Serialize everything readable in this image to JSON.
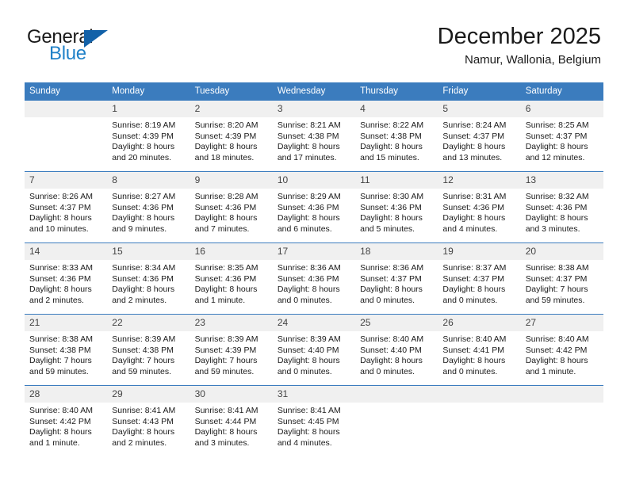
{
  "brand": {
    "name_part1": "General",
    "name_part2": "Blue",
    "triangle_color": "#1261a8",
    "blue_color": "#2081c8"
  },
  "header": {
    "title": "December 2025",
    "subtitle": "Namur, Wallonia, Belgium"
  },
  "theme": {
    "header_bg": "#3b7cbe",
    "day_number_bg": "#f0f0f0",
    "text_color": "#1a1a1a"
  },
  "weekdays": [
    "Sunday",
    "Monday",
    "Tuesday",
    "Wednesday",
    "Thursday",
    "Friday",
    "Saturday"
  ],
  "weeks": [
    [
      {
        "day": "",
        "empty": true,
        "sunrise": "",
        "sunset": "",
        "daylight_line1": "",
        "daylight_line2": ""
      },
      {
        "day": "1",
        "sunrise": "Sunrise: 8:19 AM",
        "sunset": "Sunset: 4:39 PM",
        "daylight_line1": "Daylight: 8 hours",
        "daylight_line2": "and 20 minutes."
      },
      {
        "day": "2",
        "sunrise": "Sunrise: 8:20 AM",
        "sunset": "Sunset: 4:39 PM",
        "daylight_line1": "Daylight: 8 hours",
        "daylight_line2": "and 18 minutes."
      },
      {
        "day": "3",
        "sunrise": "Sunrise: 8:21 AM",
        "sunset": "Sunset: 4:38 PM",
        "daylight_line1": "Daylight: 8 hours",
        "daylight_line2": "and 17 minutes."
      },
      {
        "day": "4",
        "sunrise": "Sunrise: 8:22 AM",
        "sunset": "Sunset: 4:38 PM",
        "daylight_line1": "Daylight: 8 hours",
        "daylight_line2": "and 15 minutes."
      },
      {
        "day": "5",
        "sunrise": "Sunrise: 8:24 AM",
        "sunset": "Sunset: 4:37 PM",
        "daylight_line1": "Daylight: 8 hours",
        "daylight_line2": "and 13 minutes."
      },
      {
        "day": "6",
        "sunrise": "Sunrise: 8:25 AM",
        "sunset": "Sunset: 4:37 PM",
        "daylight_line1": "Daylight: 8 hours",
        "daylight_line2": "and 12 minutes."
      }
    ],
    [
      {
        "day": "7",
        "sunrise": "Sunrise: 8:26 AM",
        "sunset": "Sunset: 4:37 PM",
        "daylight_line1": "Daylight: 8 hours",
        "daylight_line2": "and 10 minutes."
      },
      {
        "day": "8",
        "sunrise": "Sunrise: 8:27 AM",
        "sunset": "Sunset: 4:36 PM",
        "daylight_line1": "Daylight: 8 hours",
        "daylight_line2": "and 9 minutes."
      },
      {
        "day": "9",
        "sunrise": "Sunrise: 8:28 AM",
        "sunset": "Sunset: 4:36 PM",
        "daylight_line1": "Daylight: 8 hours",
        "daylight_line2": "and 7 minutes."
      },
      {
        "day": "10",
        "sunrise": "Sunrise: 8:29 AM",
        "sunset": "Sunset: 4:36 PM",
        "daylight_line1": "Daylight: 8 hours",
        "daylight_line2": "and 6 minutes."
      },
      {
        "day": "11",
        "sunrise": "Sunrise: 8:30 AM",
        "sunset": "Sunset: 4:36 PM",
        "daylight_line1": "Daylight: 8 hours",
        "daylight_line2": "and 5 minutes."
      },
      {
        "day": "12",
        "sunrise": "Sunrise: 8:31 AM",
        "sunset": "Sunset: 4:36 PM",
        "daylight_line1": "Daylight: 8 hours",
        "daylight_line2": "and 4 minutes."
      },
      {
        "day": "13",
        "sunrise": "Sunrise: 8:32 AM",
        "sunset": "Sunset: 4:36 PM",
        "daylight_line1": "Daylight: 8 hours",
        "daylight_line2": "and 3 minutes."
      }
    ],
    [
      {
        "day": "14",
        "sunrise": "Sunrise: 8:33 AM",
        "sunset": "Sunset: 4:36 PM",
        "daylight_line1": "Daylight: 8 hours",
        "daylight_line2": "and 2 minutes."
      },
      {
        "day": "15",
        "sunrise": "Sunrise: 8:34 AM",
        "sunset": "Sunset: 4:36 PM",
        "daylight_line1": "Daylight: 8 hours",
        "daylight_line2": "and 2 minutes."
      },
      {
        "day": "16",
        "sunrise": "Sunrise: 8:35 AM",
        "sunset": "Sunset: 4:36 PM",
        "daylight_line1": "Daylight: 8 hours",
        "daylight_line2": "and 1 minute."
      },
      {
        "day": "17",
        "sunrise": "Sunrise: 8:36 AM",
        "sunset": "Sunset: 4:36 PM",
        "daylight_line1": "Daylight: 8 hours",
        "daylight_line2": "and 0 minutes."
      },
      {
        "day": "18",
        "sunrise": "Sunrise: 8:36 AM",
        "sunset": "Sunset: 4:37 PM",
        "daylight_line1": "Daylight: 8 hours",
        "daylight_line2": "and 0 minutes."
      },
      {
        "day": "19",
        "sunrise": "Sunrise: 8:37 AM",
        "sunset": "Sunset: 4:37 PM",
        "daylight_line1": "Daylight: 8 hours",
        "daylight_line2": "and 0 minutes."
      },
      {
        "day": "20",
        "sunrise": "Sunrise: 8:38 AM",
        "sunset": "Sunset: 4:37 PM",
        "daylight_line1": "Daylight: 7 hours",
        "daylight_line2": "and 59 minutes."
      }
    ],
    [
      {
        "day": "21",
        "sunrise": "Sunrise: 8:38 AM",
        "sunset": "Sunset: 4:38 PM",
        "daylight_line1": "Daylight: 7 hours",
        "daylight_line2": "and 59 minutes."
      },
      {
        "day": "22",
        "sunrise": "Sunrise: 8:39 AM",
        "sunset": "Sunset: 4:38 PM",
        "daylight_line1": "Daylight: 7 hours",
        "daylight_line2": "and 59 minutes."
      },
      {
        "day": "23",
        "sunrise": "Sunrise: 8:39 AM",
        "sunset": "Sunset: 4:39 PM",
        "daylight_line1": "Daylight: 7 hours",
        "daylight_line2": "and 59 minutes."
      },
      {
        "day": "24",
        "sunrise": "Sunrise: 8:39 AM",
        "sunset": "Sunset: 4:40 PM",
        "daylight_line1": "Daylight: 8 hours",
        "daylight_line2": "and 0 minutes."
      },
      {
        "day": "25",
        "sunrise": "Sunrise: 8:40 AM",
        "sunset": "Sunset: 4:40 PM",
        "daylight_line1": "Daylight: 8 hours",
        "daylight_line2": "and 0 minutes."
      },
      {
        "day": "26",
        "sunrise": "Sunrise: 8:40 AM",
        "sunset": "Sunset: 4:41 PM",
        "daylight_line1": "Daylight: 8 hours",
        "daylight_line2": "and 0 minutes."
      },
      {
        "day": "27",
        "sunrise": "Sunrise: 8:40 AM",
        "sunset": "Sunset: 4:42 PM",
        "daylight_line1": "Daylight: 8 hours",
        "daylight_line2": "and 1 minute."
      }
    ],
    [
      {
        "day": "28",
        "sunrise": "Sunrise: 8:40 AM",
        "sunset": "Sunset: 4:42 PM",
        "daylight_line1": "Daylight: 8 hours",
        "daylight_line2": "and 1 minute."
      },
      {
        "day": "29",
        "sunrise": "Sunrise: 8:41 AM",
        "sunset": "Sunset: 4:43 PM",
        "daylight_line1": "Daylight: 8 hours",
        "daylight_line2": "and 2 minutes."
      },
      {
        "day": "30",
        "sunrise": "Sunrise: 8:41 AM",
        "sunset": "Sunset: 4:44 PM",
        "daylight_line1": "Daylight: 8 hours",
        "daylight_line2": "and 3 minutes."
      },
      {
        "day": "31",
        "sunrise": "Sunrise: 8:41 AM",
        "sunset": "Sunset: 4:45 PM",
        "daylight_line1": "Daylight: 8 hours",
        "daylight_line2": "and 4 minutes."
      },
      {
        "day": "",
        "empty": true,
        "sunrise": "",
        "sunset": "",
        "daylight_line1": "",
        "daylight_line2": ""
      },
      {
        "day": "",
        "empty": true,
        "sunrise": "",
        "sunset": "",
        "daylight_line1": "",
        "daylight_line2": ""
      },
      {
        "day": "",
        "empty": true,
        "sunrise": "",
        "sunset": "",
        "daylight_line1": "",
        "daylight_line2": ""
      }
    ]
  ]
}
